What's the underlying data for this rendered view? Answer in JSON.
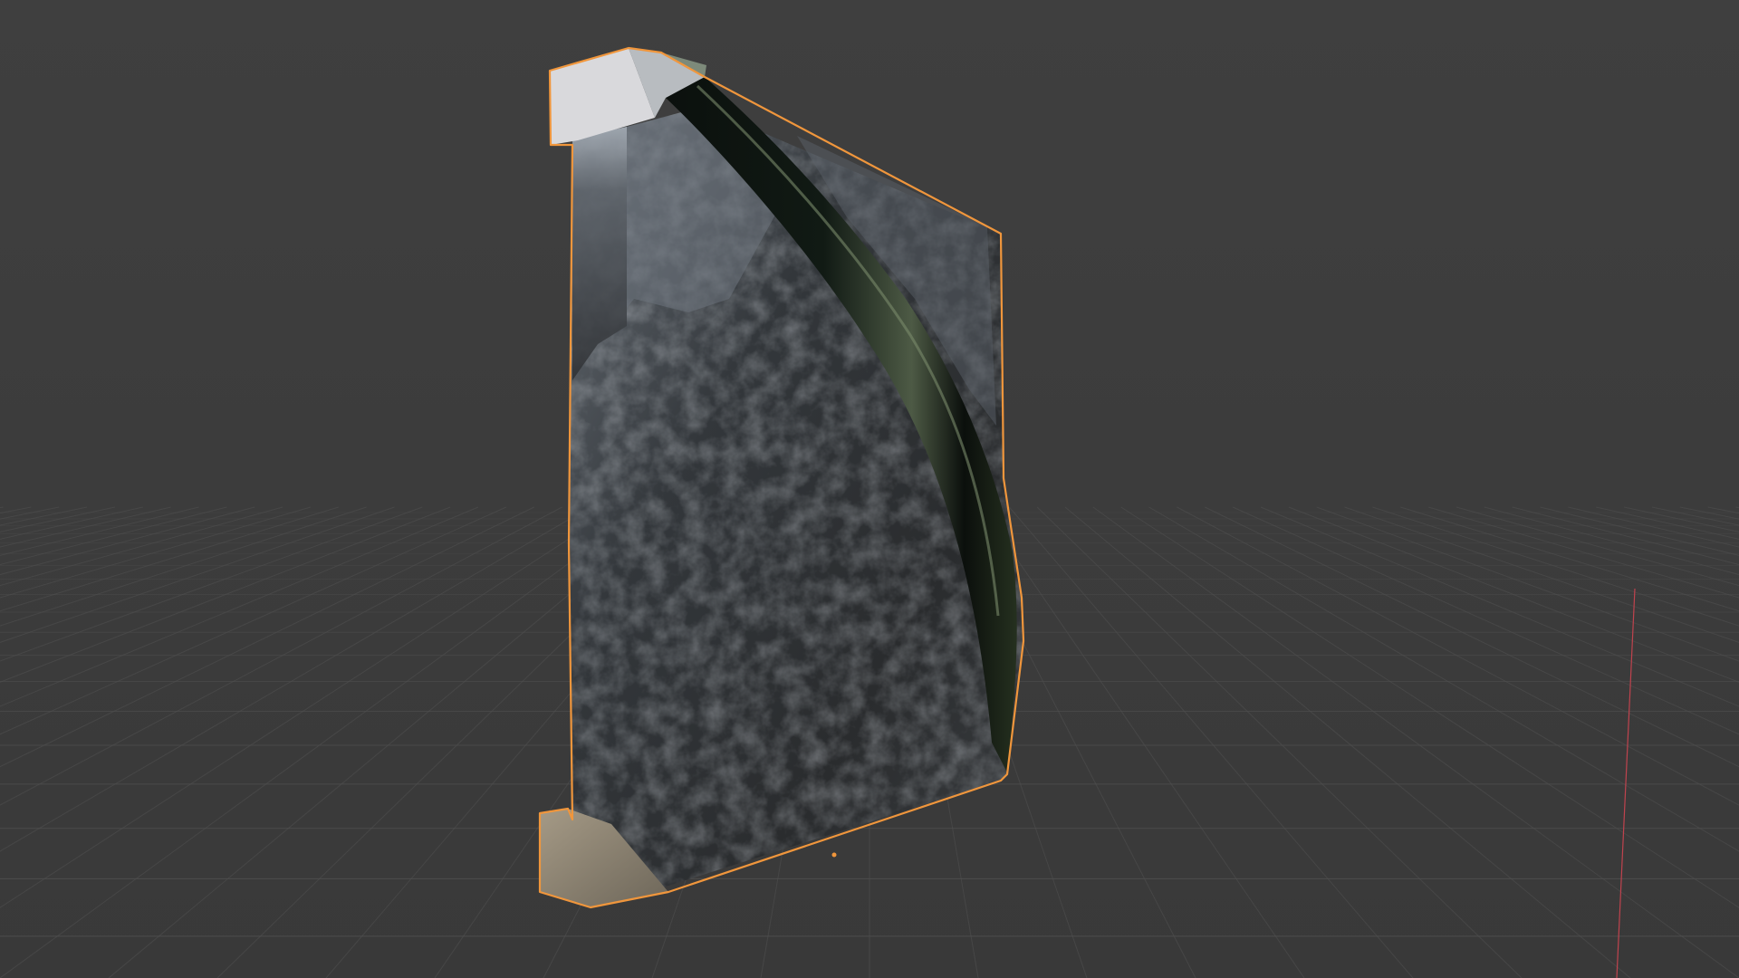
{
  "viewport": {
    "background_top": "#3f3f3f",
    "background_bottom": "#393939",
    "grid_color": "#4f4f4f",
    "x_axis_color": "#c0434e",
    "selection_outline_color": "#f0963c",
    "origin_marker_color": "#f0963c"
  },
  "object": {
    "name_icon": "cube-icon",
    "selected": true,
    "materials": {
      "rock_dark": "#2c2e31",
      "rock_light": "#9aa3ad",
      "cap_top": "#d9d9dc",
      "cap_bottom": "#8b8272",
      "water_channel": "#0c1410",
      "water_highlight": "#6f7d63"
    }
  }
}
